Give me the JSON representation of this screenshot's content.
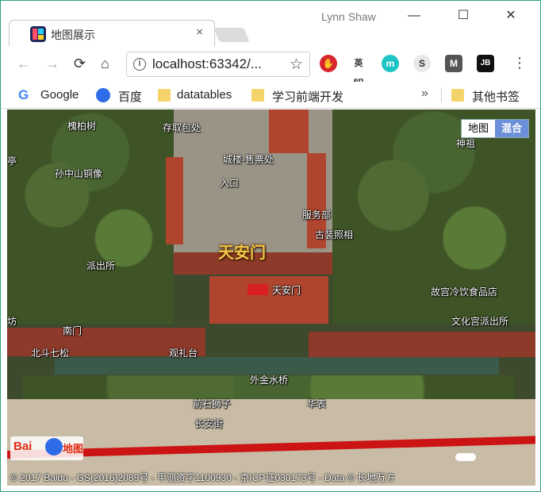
{
  "window": {
    "tab_title": "地图展示",
    "tab_close": "×",
    "user_name": "Lynn Shaw",
    "minimize": "—",
    "maximize": "☐",
    "close": "✕"
  },
  "toolbar": {
    "back": "←",
    "forward": "→",
    "reload": "⟳",
    "home": "⌂",
    "url": "localhost:63342/...",
    "info": "i",
    "star": "☆",
    "menu": "⋮",
    "extensions": {
      "stop": "✋",
      "translate": "英en",
      "m": "m",
      "s": "S",
      "shield": "M",
      "jb": "JB"
    }
  },
  "bookmarks": {
    "google_icon": "G",
    "items": [
      "Google",
      "百度",
      "datatables",
      "学习前端开发"
    ],
    "more": "»",
    "other": "其他书签"
  },
  "map": {
    "map_type": {
      "map": "地图",
      "hybrid": "混合",
      "active": "hybrid"
    },
    "main_label": "天安门",
    "labels": {
      "huaibaishu": "槐柏树",
      "cunfangbao": "存取包处",
      "ting": "亭",
      "sunzhongshan": "孙中山铜像",
      "chengluo": "城楼-售票处",
      "rukou": "入口",
      "fuwubu": "服务部",
      "guzhuang": "古装照相",
      "paichusuo": "派出所",
      "tiananmen_small": "天安门",
      "gugong": "故宫冷饮食品店",
      "fang": "坊",
      "nanmen": "南门",
      "wenhua": "文化宫派出所",
      "beidou": "北斗七松",
      "guanlitai": "观礼台",
      "jinshui": "外金水桥",
      "shizi": "前石狮子",
      "huabiao": "华表",
      "changan": "长安街",
      "shenzhi": "神祖"
    },
    "logo": {
      "text": "Bai",
      "suffix": "地图"
    },
    "copyright": "© 2017 Baidu - GS(2016)2089号 - 甲测资字1100930 - 京ICP证030173号 - Data © 长地万方"
  }
}
